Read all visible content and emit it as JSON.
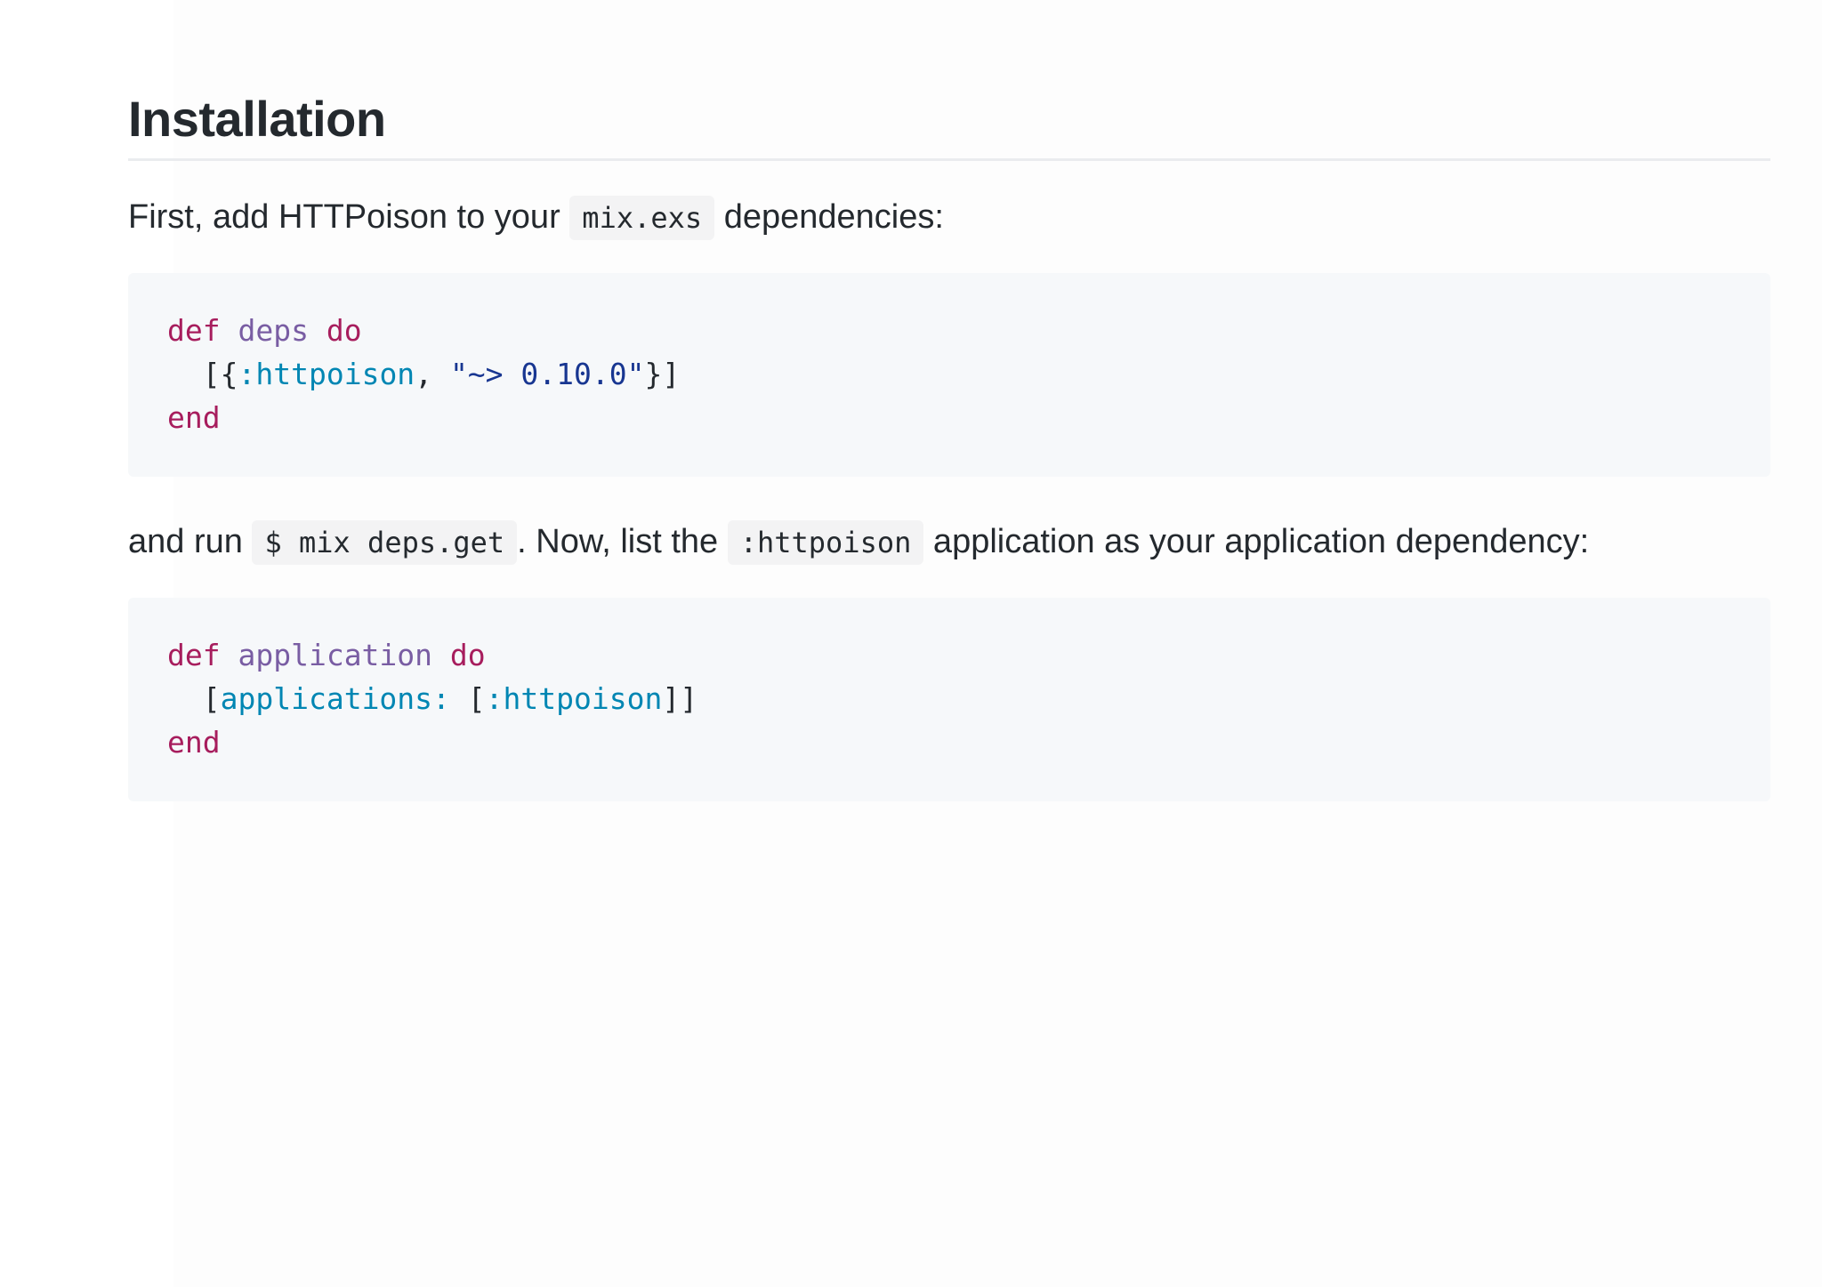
{
  "heading": "Installation",
  "para1": {
    "before": "First, add HTTPoison to your ",
    "code": "mix.exs",
    "after": " dependencies:"
  },
  "code_block_1": {
    "line1": {
      "kw1": "def",
      "fn": "deps",
      "kw2": "do"
    },
    "line2": {
      "open": "[{",
      "atom": ":httpoison",
      "comma": ", ",
      "str": "\"~> 0.10.0\"",
      "close": "}]"
    },
    "line3": {
      "kw": "end"
    }
  },
  "para2": {
    "before": "and run ",
    "code1": "$ mix deps.get",
    "middle": ". Now, list the ",
    "code2": ":httpoison",
    "after": " application as your application dependency:"
  },
  "code_block_2": {
    "line1": {
      "kw1": "def",
      "fn": "application",
      "kw2": "do"
    },
    "line2": {
      "open": "[",
      "key": "applications:",
      "space": " [",
      "atom": ":httpoison",
      "close": "]]"
    },
    "line3": {
      "kw": "end"
    }
  }
}
